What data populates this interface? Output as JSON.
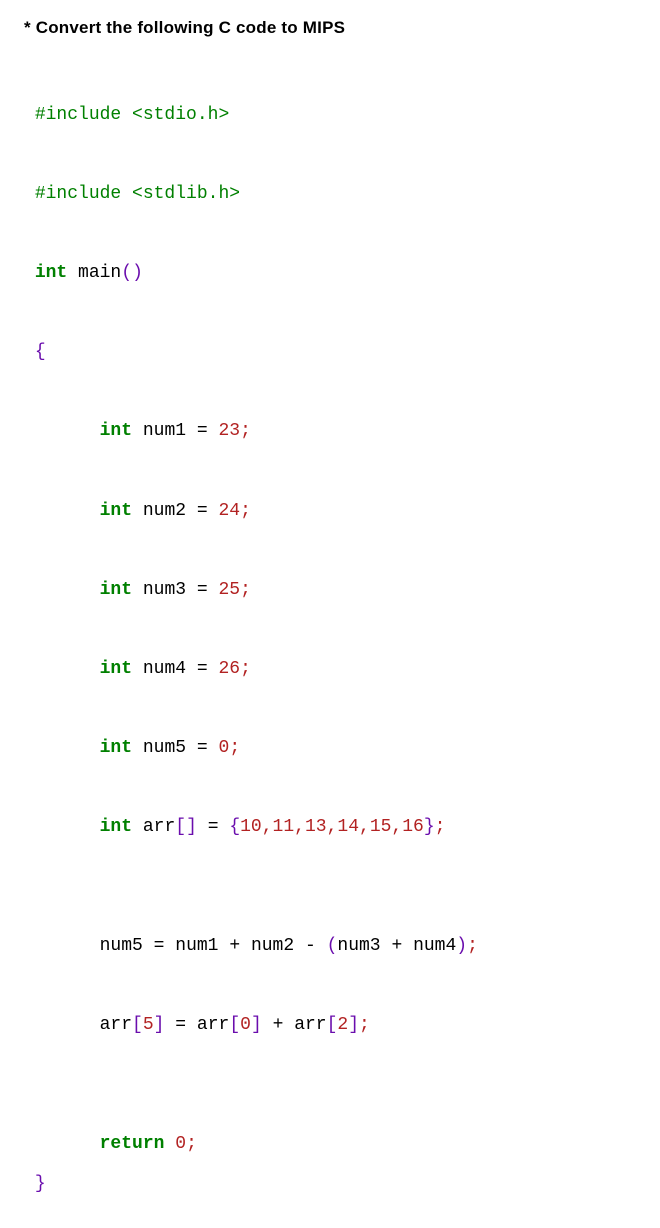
{
  "title": "* Convert the following C code to MIPS",
  "code": {
    "pp1": "#include <stdio.h>",
    "pp2": "#include <stdlib.h>",
    "kw_int": "int",
    "kw_return": "return",
    "id_main": "main",
    "id_num1": "num1",
    "id_num2": "num2",
    "id_num3": "num3",
    "id_num4": "num4",
    "id_num5": "num5",
    "id_arr": "arr",
    "val_num1": "23",
    "val_num2": "24",
    "val_num3": "25",
    "val_num4": "26",
    "val_num5": "0",
    "arr_v0": "10",
    "arr_v1": "11",
    "arr_v2": "13",
    "arr_v3": "14",
    "arr_v4": "15",
    "arr_v5": "16",
    "idx0": "0",
    "idx2": "2",
    "idx5": "5",
    "ret_val": "0",
    "semi": ";"
  }
}
